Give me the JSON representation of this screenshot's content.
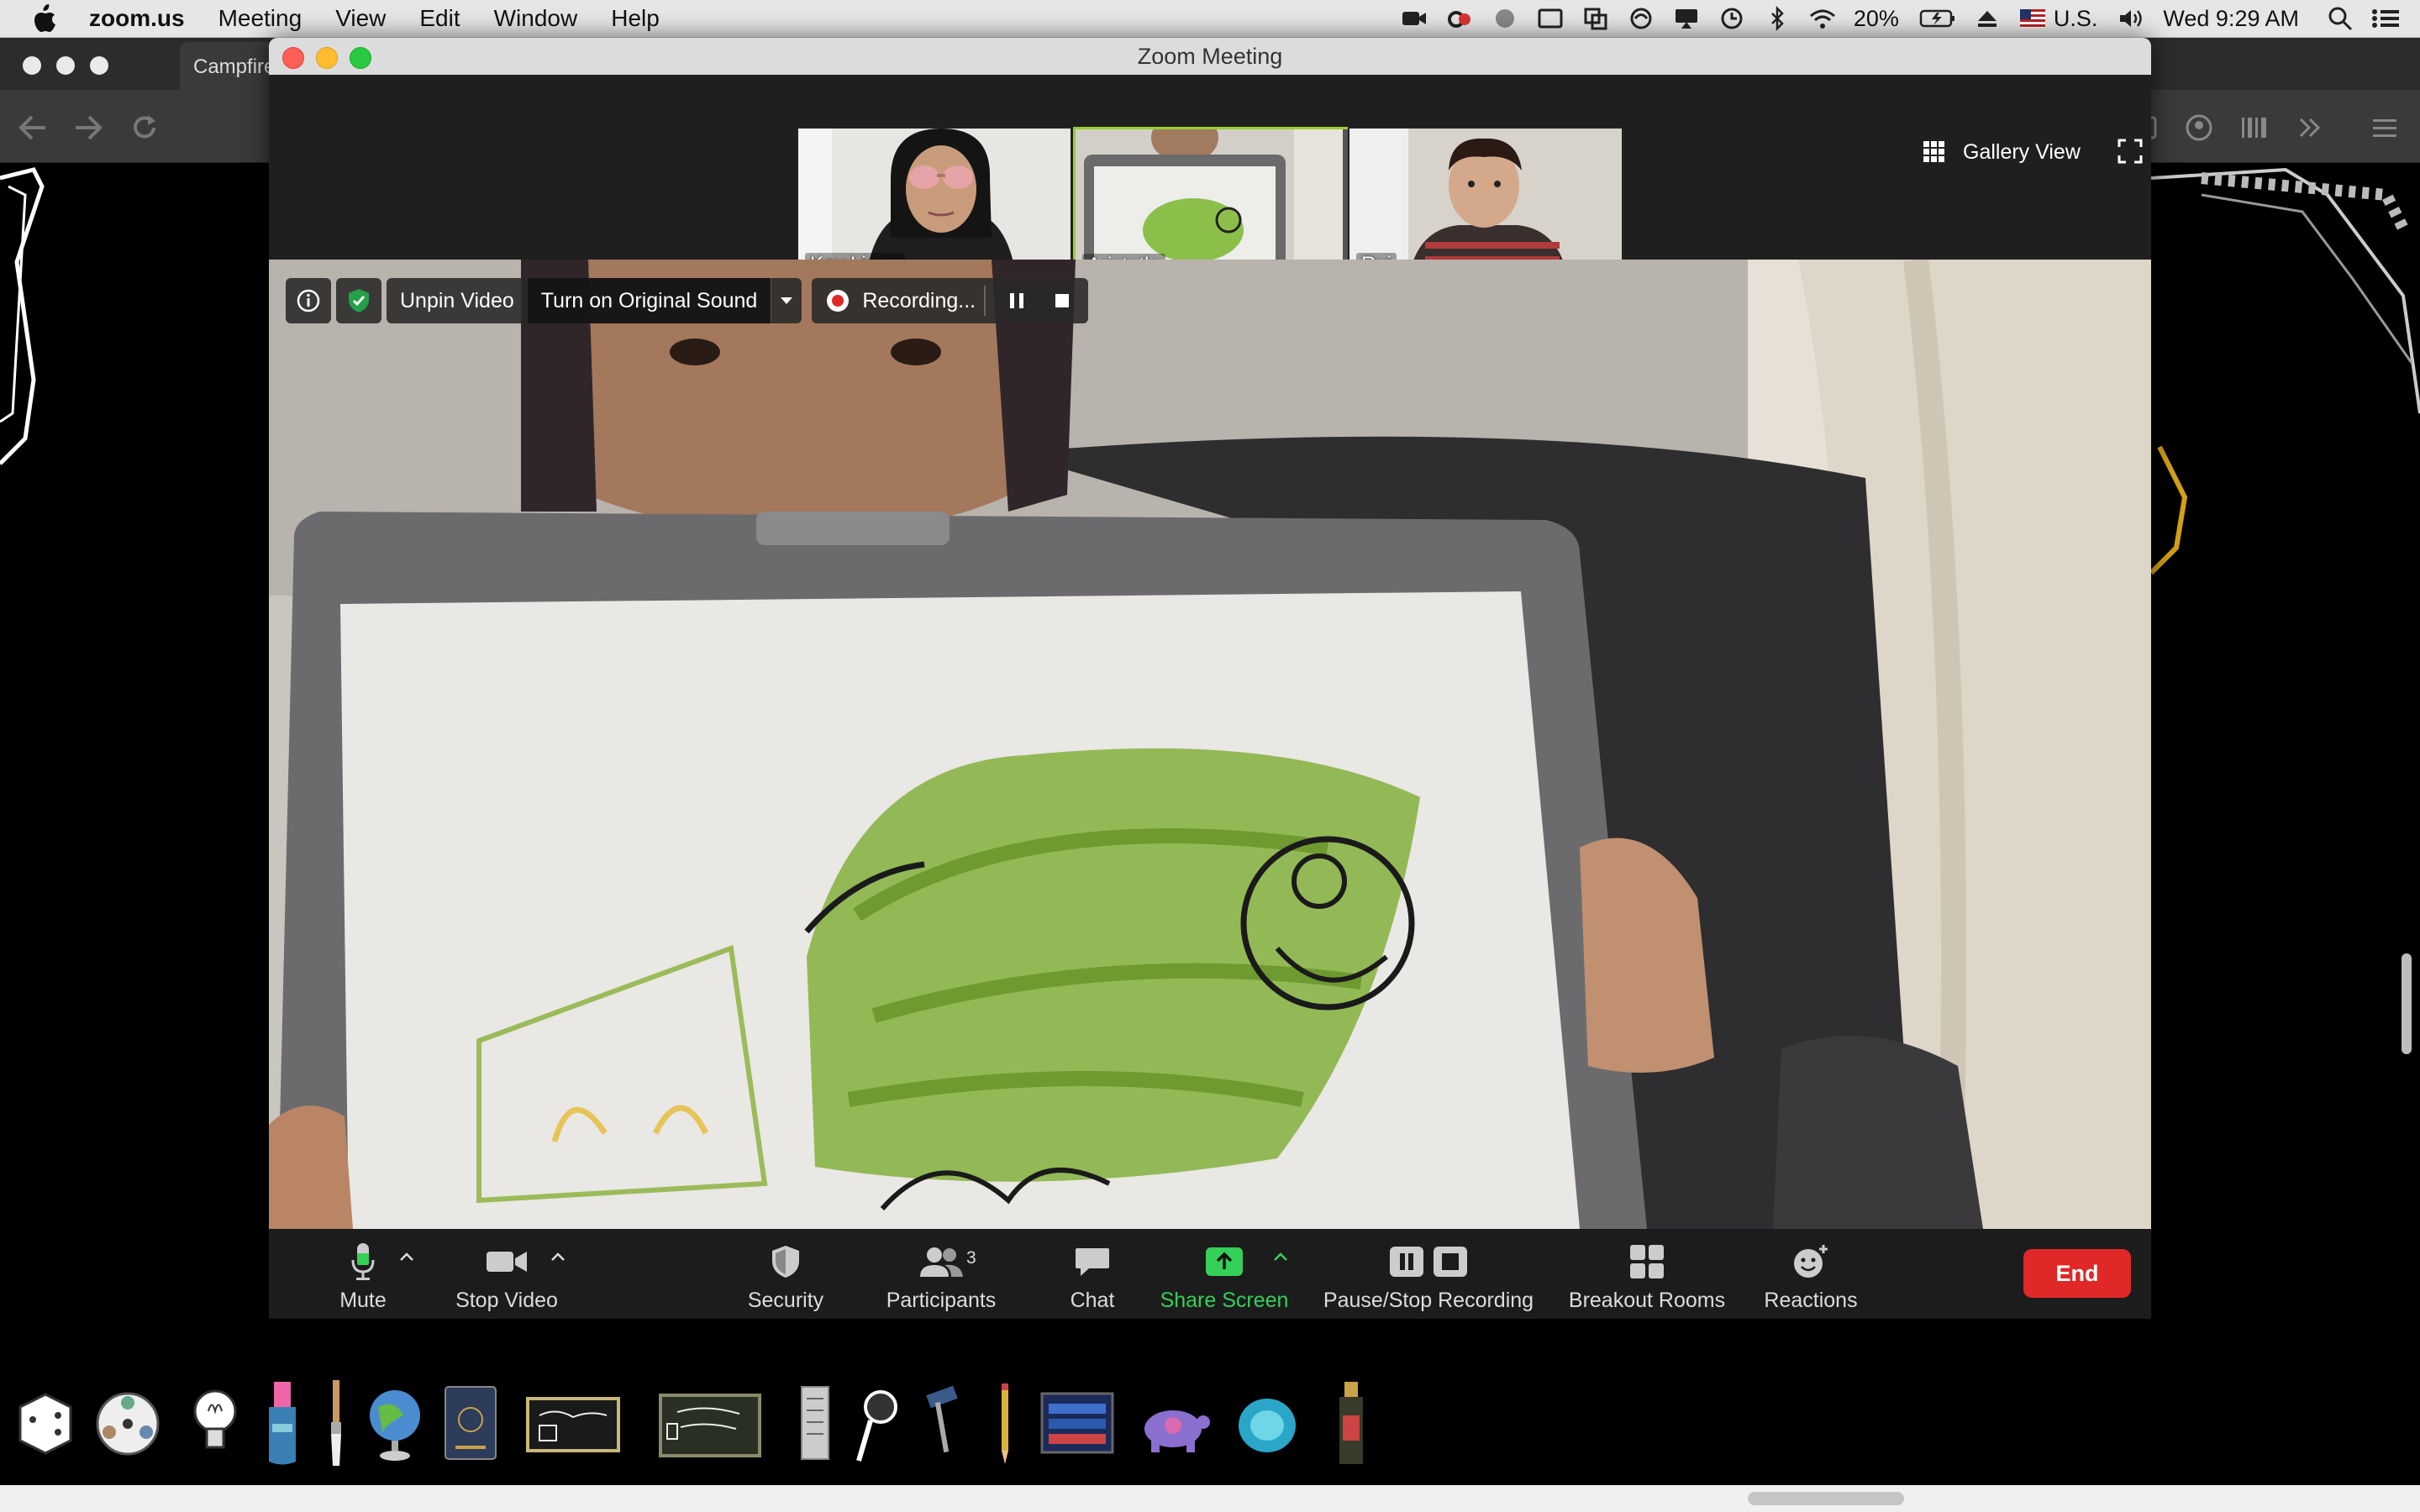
{
  "menubar": {
    "app_name": "zoom.us",
    "items": [
      "Meeting",
      "View",
      "Edit",
      "Window",
      "Help"
    ],
    "battery": "20%",
    "input_source": "U.S.",
    "clock": "Wed 9:29 AM"
  },
  "browser": {
    "tab_title": "Campfire"
  },
  "zoom": {
    "window_title": "Zoom Meeting",
    "view_mode": "Gallery View",
    "participants": [
      {
        "name": "Kay Liang",
        "active": false
      },
      {
        "name": "Aristotle",
        "active": true
      },
      {
        "name": "Rui",
        "active": false
      }
    ],
    "video_toolbar": {
      "unpin": "Unpin Video",
      "original_sound": "Turn on Original Sound",
      "recording": "Recording..."
    },
    "controls": {
      "mute": "Mute",
      "stop_video": "Stop Video",
      "security": "Security",
      "participants": "Participants",
      "participant_count": "3",
      "chat": "Chat",
      "share_screen": "Share Screen",
      "pause_stop_recording": "Pause/Stop Recording",
      "breakout_rooms": "Breakout Rooms",
      "reactions": "Reactions",
      "end": "End"
    },
    "accent_colors": {
      "end": "#e02828",
      "share": "#34d058",
      "active_speaker": "#9acd32",
      "security_badge": "#24a148"
    }
  },
  "dock_items": [
    "dice-icon",
    "wheel-icon",
    "lightbulb-icon",
    "potion-bottle-icon",
    "paintbrush-icon",
    "globe-icon",
    "passport-icon",
    "chalkboard-sign-icon",
    "chalkboard-sign-2-icon",
    "paper-scroll-icon",
    "magnifying-glass-icon",
    "hammer-icon",
    "pencil-icon",
    "screen-display-icon",
    "turtle-icon",
    "gemstone-icon",
    "bottle-icon"
  ]
}
